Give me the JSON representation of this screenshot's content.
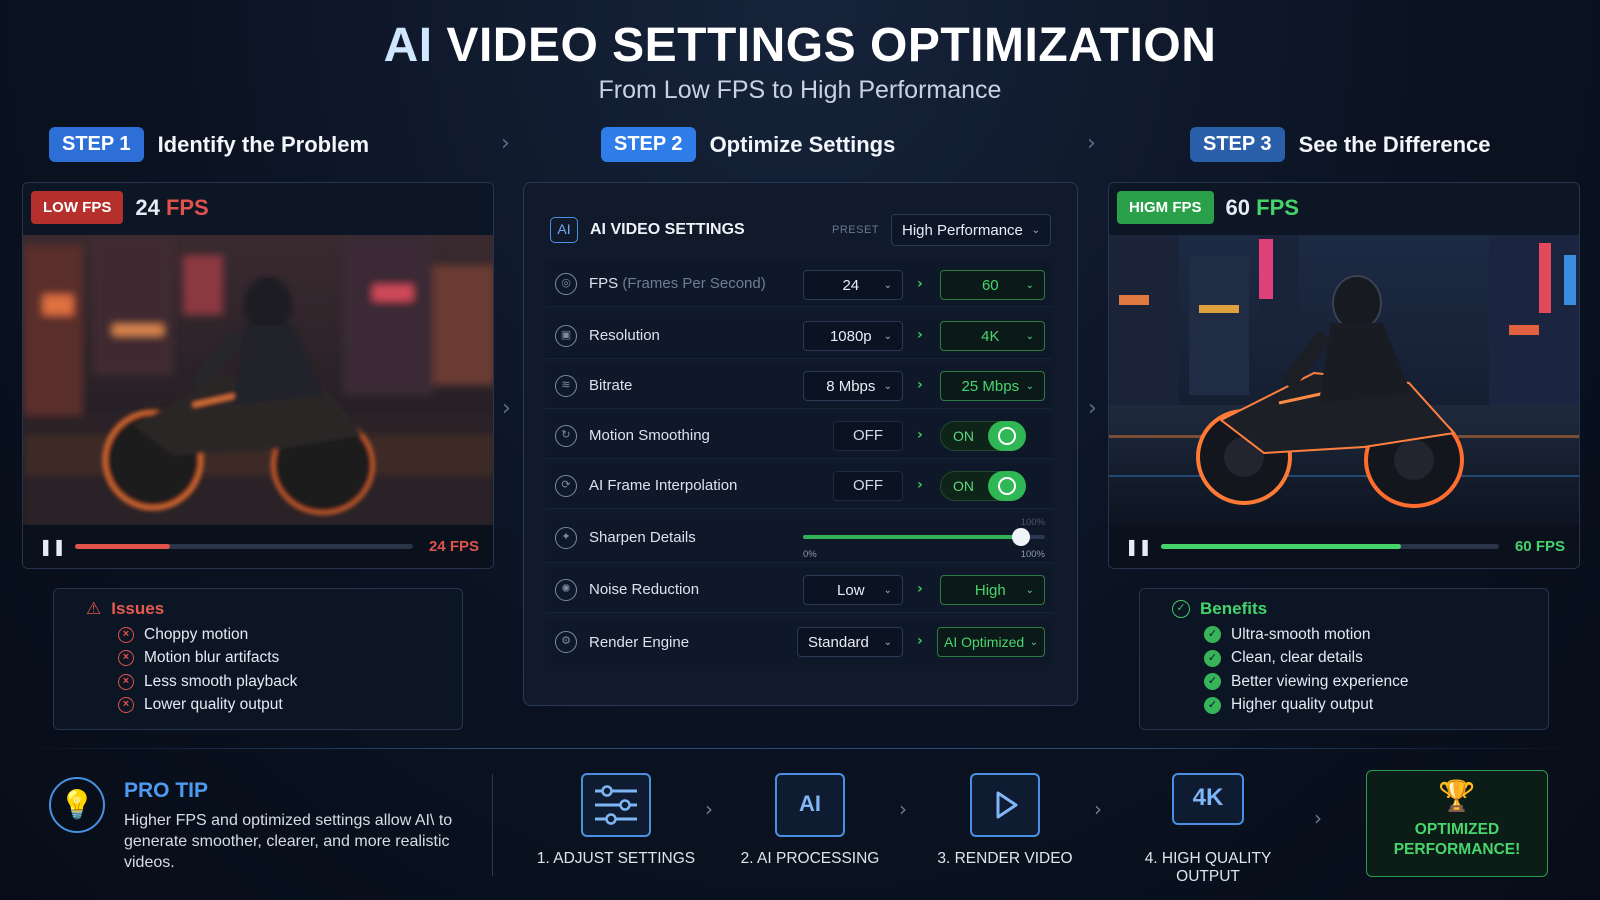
{
  "header": {
    "title_ai": "AI",
    "title_rest": " VIDEO SETTINGS OPTIMIZATION",
    "subtitle": "From Low FPS to High Performance"
  },
  "steps": [
    {
      "badge": "STEP 1",
      "title": "Identify the Problem"
    },
    {
      "badge": "STEP 2",
      "title": "Optimize Settings"
    },
    {
      "badge": "STEP 3",
      "title": "See the Difference"
    }
  ],
  "low_panel": {
    "badge": "LOW FPS",
    "fps_number": "24",
    "fps_unit": "FPS",
    "bar_label": "24 FPS",
    "progress": 0.28,
    "accent": "#e0534b",
    "badge_color": "#b5302c"
  },
  "high_panel": {
    "badge": "HIGM FPS",
    "fps_number": "60",
    "fps_unit": "FPS",
    "bar_label": "60 FPS",
    "progress": 0.71,
    "accent": "#45d469",
    "badge_color": "#2aa04a"
  },
  "issues": {
    "title": "Issues",
    "items": [
      "Choppy motion",
      "Motion blur artifacts",
      "Less smooth playback",
      "Lower quality output"
    ]
  },
  "benefits": {
    "title": "Benefits",
    "items": [
      "Ultra-smooth motion",
      "Clean, clear details",
      "Better viewing experience",
      "Higher quality output"
    ]
  },
  "settings": {
    "logo": "AI",
    "title": "AI VIDEO SETTINGS",
    "preset_label": "PRESET",
    "preset_value": "High Performance",
    "rows": {
      "fps": {
        "label": "FPS",
        "label_dim": "(Frames Per Second)",
        "from": "24",
        "to": "60"
      },
      "resolution": {
        "label": "Resolution",
        "from": "1080p",
        "to": "4K"
      },
      "bitrate": {
        "label": "Bitrate",
        "from": "8 Mbps",
        "to": "25 Mbps"
      },
      "motion": {
        "label": "Motion Smoothing",
        "from": "OFF",
        "to": "ON"
      },
      "interp": {
        "label": "AI Frame Interpolation",
        "from": "OFF",
        "to": "ON"
      },
      "sharpen": {
        "label": "Sharpen Details",
        "min_label": "0%",
        "max_label": "100%",
        "top_label": "100%",
        "level": 0.9
      },
      "noise": {
        "label": "Noise Reduction",
        "from": "Low",
        "to": "High"
      },
      "render": {
        "label": "Render Engine",
        "from": "Standard",
        "to": "AI Optimized"
      }
    }
  },
  "pro_tip": {
    "title": "PRO TIP",
    "text": "Higher FPS and optimized settings allow AI\\ to generate smoother, clearer, and more realistic videos."
  },
  "pipeline": [
    {
      "label": "1. ADJUST SETTINGS",
      "icon": "sliders-icon"
    },
    {
      "label": "2. AI PROCESSING",
      "icon": "ai-chip-icon",
      "box_text": "AI"
    },
    {
      "label": "3. RENDER VIDEO",
      "icon": "play-video-icon"
    },
    {
      "label": "4. HIGH QUALITY OUTPUT",
      "icon": "monitor-4k-icon",
      "box_text": "4K"
    }
  ],
  "optimized": {
    "line1": "OPTIMIZED",
    "line2": "PERFORMANCE!"
  }
}
